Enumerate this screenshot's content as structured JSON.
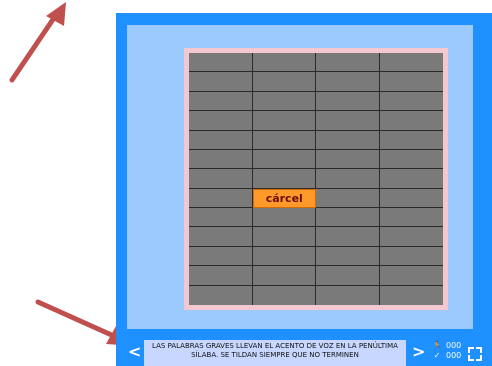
{
  "top_text": "",
  "board": {
    "rows": 13,
    "cols": 4,
    "highlight_word": "cárcel"
  },
  "message": "LAS PALABRAS GRAVES LLEVAN EL ACENTO DE VOZ EN LA PENÚLTIMA SÍLABA. SE TILDAN SIEMPRE QUE NO TERMINEN",
  "counters": {
    "moves_value": "000",
    "correct_value": "000"
  },
  "nav": {
    "prev_label": "<",
    "next_label": ">"
  },
  "icons": {
    "runner": "runner-icon",
    "check": "check-icon",
    "fullscreen": "fullscreen-icon"
  },
  "colors": {
    "frame": "#1e90ff",
    "panel": "#9ccaff",
    "board_border": "#f3c9cf",
    "tile": "#7a7a7a",
    "highlight": "#ff9a2a",
    "annotation_arrow": "#c0504d"
  }
}
